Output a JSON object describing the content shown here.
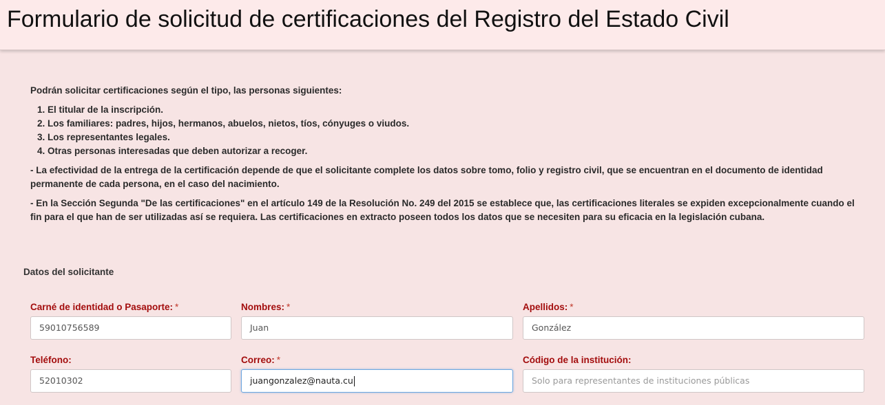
{
  "header": {
    "title": "Formulario de solicitud de certificaciones del Registro del Estado Civil"
  },
  "info": {
    "intro": "Podrán solicitar certificaciones según el tipo, las personas siguientes:",
    "list": [
      "El titular de la inscripción.",
      "Los familiares: padres, hijos, hermanos, abuelos, nietos, tíos, cónyuges o viudos.",
      "Los representantes legales.",
      "Otras personas interesadas que deben autorizar a recoger."
    ],
    "note1": "- La efectividad de la entrega de la certificación depende de que el solicitante complete los datos sobre tomo, folio y registro civil, que se encuentran en el documento de identidad permanente de cada persona, en el caso del nacimiento.",
    "note2": "- En la Sección Segunda \"De las certificaciones\" en el artículo 149 de la Resolución No. 249 del 2015 se establece que, las certificaciones literales se expiden excepcionalmente cuando el fin para el que han de ser utilizadas así se requiera. Las certificaciones en extracto poseen todos los datos que se necesiten para su eficacia en la legislación cubana."
  },
  "form": {
    "section_title": "Datos del solicitante",
    "required_mark": "*",
    "id": {
      "label": "Carné de identidad o Pasaporte:",
      "value": "59010756589"
    },
    "nombres": {
      "label": "Nombres:",
      "value": "Juan"
    },
    "apellidos": {
      "label": "Apellidos:",
      "value": "González"
    },
    "telefono": {
      "label": "Teléfono:",
      "value": "52010302"
    },
    "correo": {
      "label": "Correo:",
      "value": "juangonzalez@nauta.cu"
    },
    "codigo": {
      "label": "Código de la institución:",
      "placeholder": "Solo para representantes de instituciones públicas"
    }
  }
}
